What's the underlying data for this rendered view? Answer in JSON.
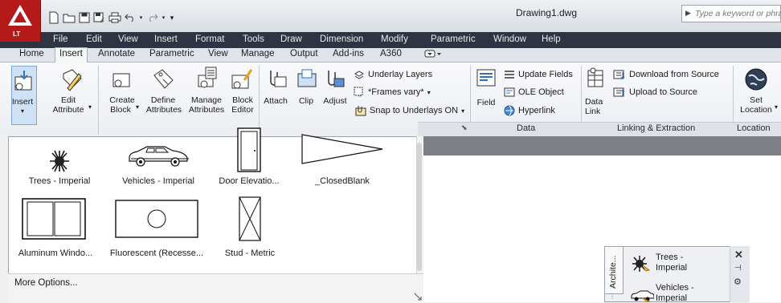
{
  "app": {
    "logo_text": "LT",
    "document_title": "Drawing1.dwg"
  },
  "search": {
    "placeholder": "Type a keyword or phrase"
  },
  "menu": [
    "File",
    "Edit",
    "View",
    "Insert",
    "Format",
    "Tools",
    "Draw",
    "Dimension",
    "Modify",
    "Parametric",
    "Window",
    "Help"
  ],
  "tabs": [
    "Home",
    "Insert",
    "Annotate",
    "Parametric",
    "View",
    "Manage",
    "Output",
    "Add-ins",
    "A360"
  ],
  "active_tab": "Insert",
  "ribbon": {
    "insert": "Insert",
    "edit_attribute": [
      "Edit",
      "Attribute"
    ],
    "create_block": [
      "Create",
      "Block"
    ],
    "define_attributes": [
      "Define",
      "Attributes"
    ],
    "manage_attributes": [
      "Manage",
      "Attributes"
    ],
    "block_editor": [
      "Block",
      "Editor"
    ],
    "attach": "Attach",
    "clip": "Clip",
    "adjust": "Adjust",
    "underlay_layers": "Underlay Layers",
    "frames_vary": "*Frames vary*",
    "snap_to_underlays": "Snap to Underlays ON",
    "field": "Field",
    "update_fields": "Update Fields",
    "ole_object": "OLE Object",
    "hyperlink": "Hyperlink",
    "data_link": [
      "Data",
      "Link"
    ],
    "download_from_source": "Download from Source",
    "upload_to_source": "Upload to Source",
    "set_location": [
      "Set",
      "Location"
    ],
    "panels": {
      "data": "Data",
      "linking": "Linking & Extraction",
      "location": "Location"
    }
  },
  "gallery": {
    "items": [
      "Trees - Imperial",
      "Vehicles - Imperial",
      "Door Elevatio...",
      "_ClosedBlank",
      "Aluminum Windo...",
      "Fluorescent (Recesse...",
      "Stud - Metric"
    ],
    "more_options": "More Options..."
  },
  "palette": {
    "tab_label": "Archite...",
    "items": [
      [
        "Trees -",
        "Imperial"
      ],
      [
        "Vehicles -",
        "Imperial"
      ]
    ]
  }
}
